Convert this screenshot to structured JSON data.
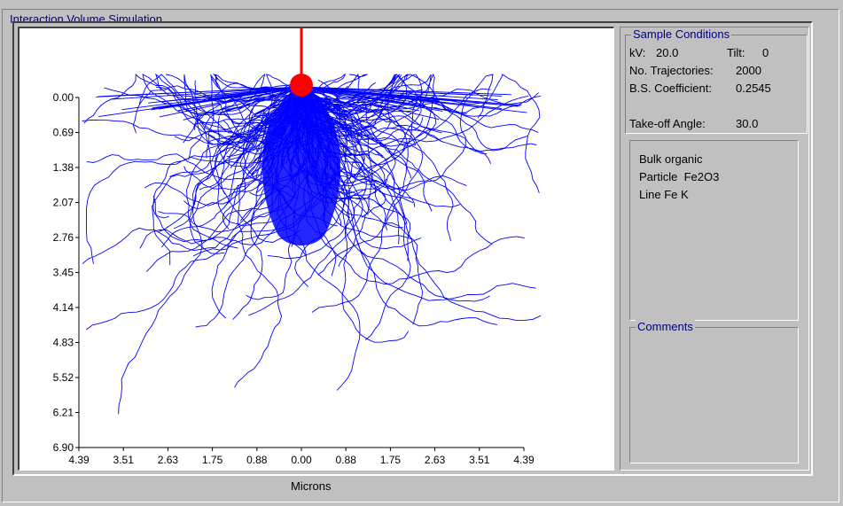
{
  "window": {
    "title": "Interaction Volume Simulation"
  },
  "plot": {
    "y_ticks": [
      "0.00",
      "0.69",
      "1.38",
      "2.07",
      "2.76",
      "3.45",
      "4.14",
      "4.83",
      "5.52",
      "6.21",
      "6.90"
    ],
    "x_ticks": [
      "4.39",
      "3.51",
      "2.63",
      "1.75",
      "0.88",
      "0.00",
      "0.88",
      "1.75",
      "2.63",
      "3.51",
      "4.39"
    ],
    "x_axis_label": "Microns",
    "beam_color": "#ff0000",
    "trajectory_color": "#0000ff"
  },
  "sample_conditions": {
    "title": "Sample Conditions",
    "kv_label": "kV:",
    "kv_value": "20.0",
    "tilt_label": "Tilt:",
    "tilt_value": "0",
    "trajectories_label": "No. Trajectories:",
    "trajectories_value": "2000",
    "bs_label": "B.S. Coefficient:",
    "bs_value": "0.2545",
    "takeoff_label": "Take-off Angle:",
    "takeoff_value": "30.0"
  },
  "materials": {
    "line1": "Bulk organic",
    "line2": "Particle  Fe2O3",
    "line3": "Line Fe K"
  },
  "comments": {
    "title": "Comments",
    "text": ""
  }
}
